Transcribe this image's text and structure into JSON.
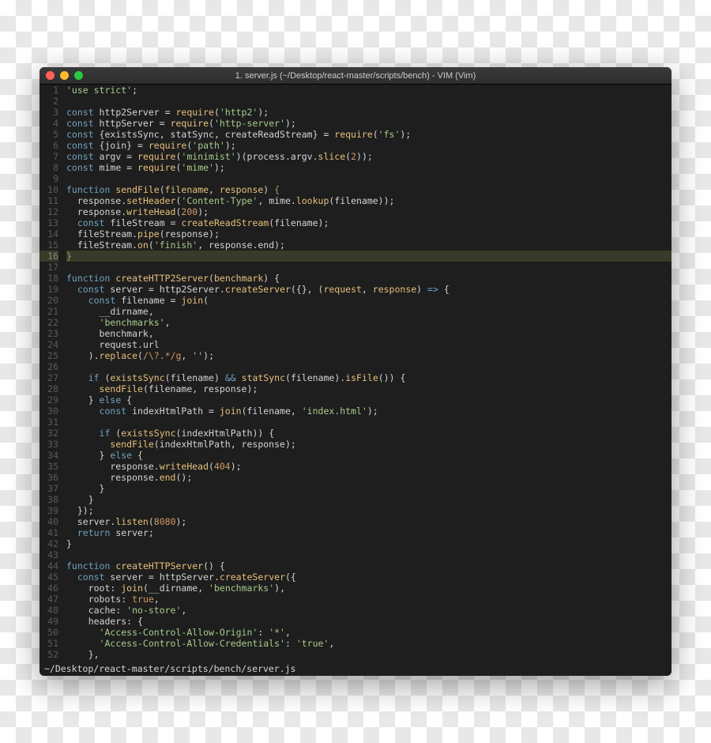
{
  "window": {
    "title": "1. server.js (~/Desktop/react-master/scripts/bench) - VIM (Vim)"
  },
  "status": "~/Desktop/react-master/scripts/bench/server.js",
  "highlight_line": 16,
  "code": [
    [
      [
        "str",
        "'use strict'"
      ],
      [
        "pl",
        ";"
      ]
    ],
    [],
    [
      [
        "kw",
        "const"
      ],
      [
        "pl",
        " http2Server = "
      ],
      [
        "fn",
        "require"
      ],
      [
        "pl",
        "("
      ],
      [
        "str",
        "'http2'"
      ],
      [
        "pl",
        ");"
      ]
    ],
    [
      [
        "kw",
        "const"
      ],
      [
        "pl",
        " httpServer = "
      ],
      [
        "fn",
        "require"
      ],
      [
        "pl",
        "("
      ],
      [
        "str",
        "'http-server'"
      ],
      [
        "pl",
        ");"
      ]
    ],
    [
      [
        "kw",
        "const"
      ],
      [
        "pl",
        " {existsSync, statSync, createReadStream} = "
      ],
      [
        "fn",
        "require"
      ],
      [
        "pl",
        "("
      ],
      [
        "str",
        "'fs'"
      ],
      [
        "pl",
        ");"
      ]
    ],
    [
      [
        "kw",
        "const"
      ],
      [
        "pl",
        " {join} = "
      ],
      [
        "fn",
        "require"
      ],
      [
        "pl",
        "("
      ],
      [
        "str",
        "'path'"
      ],
      [
        "pl",
        ");"
      ]
    ],
    [
      [
        "kw",
        "const"
      ],
      [
        "pl",
        " argv = "
      ],
      [
        "fn",
        "require"
      ],
      [
        "pl",
        "("
      ],
      [
        "str",
        "'minimist'"
      ],
      [
        "pl",
        ")(process.argv."
      ],
      [
        "fn",
        "slice"
      ],
      [
        "pl",
        "("
      ],
      [
        "num",
        "2"
      ],
      [
        "pl",
        "));"
      ]
    ],
    [
      [
        "kw",
        "const"
      ],
      [
        "pl",
        " mime = "
      ],
      [
        "fn",
        "require"
      ],
      [
        "pl",
        "("
      ],
      [
        "str",
        "'mime'"
      ],
      [
        "pl",
        ");"
      ]
    ],
    [],
    [
      [
        "kw",
        "function"
      ],
      [
        "pl",
        " "
      ],
      [
        "fn",
        "sendFile"
      ],
      [
        "pl",
        "("
      ],
      [
        "pr",
        "filename"
      ],
      [
        "pl",
        ", "
      ],
      [
        "pr",
        "response"
      ],
      [
        "pl",
        ") "
      ],
      [
        "br",
        "{"
      ]
    ],
    [
      [
        "pl",
        "  response."
      ],
      [
        "fn",
        "setHeader"
      ],
      [
        "pl",
        "("
      ],
      [
        "str",
        "'Content-Type'"
      ],
      [
        "pl",
        ", mime."
      ],
      [
        "fn",
        "lookup"
      ],
      [
        "pl",
        "(filename));"
      ]
    ],
    [
      [
        "pl",
        "  response."
      ],
      [
        "fn",
        "writeHead"
      ],
      [
        "pl",
        "("
      ],
      [
        "num",
        "200"
      ],
      [
        "pl",
        ");"
      ]
    ],
    [
      [
        "pl",
        "  "
      ],
      [
        "kw",
        "const"
      ],
      [
        "pl",
        " fileStream = "
      ],
      [
        "fn",
        "createReadStream"
      ],
      [
        "pl",
        "(filename);"
      ]
    ],
    [
      [
        "pl",
        "  fileStream."
      ],
      [
        "fn",
        "pipe"
      ],
      [
        "pl",
        "(response);"
      ]
    ],
    [
      [
        "pl",
        "  fileStream."
      ],
      [
        "fn",
        "on"
      ],
      [
        "pl",
        "("
      ],
      [
        "str",
        "'finish'"
      ],
      [
        "pl",
        ", response.end);"
      ]
    ],
    [
      [
        "br",
        "}"
      ]
    ],
    [],
    [
      [
        "kw",
        "function"
      ],
      [
        "pl",
        " "
      ],
      [
        "fn",
        "createHTTP2Server"
      ],
      [
        "pl",
        "("
      ],
      [
        "pr",
        "benchmark"
      ],
      [
        "pl",
        ") {"
      ]
    ],
    [
      [
        "pl",
        "  "
      ],
      [
        "kw",
        "const"
      ],
      [
        "pl",
        " server = http2Server."
      ],
      [
        "fn",
        "createServer"
      ],
      [
        "pl",
        "({}, ("
      ],
      [
        "pr",
        "request"
      ],
      [
        "pl",
        ", "
      ],
      [
        "pr",
        "response"
      ],
      [
        "pl",
        ") "
      ],
      [
        "kw",
        "=>"
      ],
      [
        "pl",
        " {"
      ]
    ],
    [
      [
        "pl",
        "    "
      ],
      [
        "kw",
        "const"
      ],
      [
        "pl",
        " filename = "
      ],
      [
        "fn",
        "join"
      ],
      [
        "pl",
        "("
      ]
    ],
    [
      [
        "pl",
        "      __dirname,"
      ]
    ],
    [
      [
        "pl",
        "      "
      ],
      [
        "str",
        "'benchmarks'"
      ],
      [
        "pl",
        ","
      ]
    ],
    [
      [
        "pl",
        "      benchmark,"
      ]
    ],
    [
      [
        "pl",
        "      request.url"
      ]
    ],
    [
      [
        "pl",
        "    )."
      ],
      [
        "fn",
        "replace"
      ],
      [
        "pl",
        "("
      ],
      [
        "num",
        "/\\?.*/g"
      ],
      [
        "pl",
        ", "
      ],
      [
        "str",
        "''"
      ],
      [
        "pl",
        ");"
      ]
    ],
    [],
    [
      [
        "pl",
        "    "
      ],
      [
        "kw",
        "if"
      ],
      [
        "pl",
        " ("
      ],
      [
        "fn",
        "existsSync"
      ],
      [
        "pl",
        "(filename) "
      ],
      [
        "kw",
        "&&"
      ],
      [
        "pl",
        " "
      ],
      [
        "fn",
        "statSync"
      ],
      [
        "pl",
        "(filename)."
      ],
      [
        "fn",
        "isFile"
      ],
      [
        "pl",
        "()) {"
      ]
    ],
    [
      [
        "pl",
        "      "
      ],
      [
        "fn",
        "sendFile"
      ],
      [
        "pl",
        "(filename, response);"
      ]
    ],
    [
      [
        "pl",
        "    } "
      ],
      [
        "kw",
        "else"
      ],
      [
        "pl",
        " {"
      ]
    ],
    [
      [
        "pl",
        "      "
      ],
      [
        "kw",
        "const"
      ],
      [
        "pl",
        " indexHtmlPath = "
      ],
      [
        "fn",
        "join"
      ],
      [
        "pl",
        "(filename, "
      ],
      [
        "str",
        "'index.html'"
      ],
      [
        "pl",
        ");"
      ]
    ],
    [],
    [
      [
        "pl",
        "      "
      ],
      [
        "kw",
        "if"
      ],
      [
        "pl",
        " ("
      ],
      [
        "fn",
        "existsSync"
      ],
      [
        "pl",
        "(indexHtmlPath)) {"
      ]
    ],
    [
      [
        "pl",
        "        "
      ],
      [
        "fn",
        "sendFile"
      ],
      [
        "pl",
        "(indexHtmlPath, response);"
      ]
    ],
    [
      [
        "pl",
        "      } "
      ],
      [
        "kw",
        "else"
      ],
      [
        "pl",
        " {"
      ]
    ],
    [
      [
        "pl",
        "        response."
      ],
      [
        "fn",
        "writeHead"
      ],
      [
        "pl",
        "("
      ],
      [
        "num",
        "404"
      ],
      [
        "pl",
        ");"
      ]
    ],
    [
      [
        "pl",
        "        response."
      ],
      [
        "fn",
        "end"
      ],
      [
        "pl",
        "();"
      ]
    ],
    [
      [
        "pl",
        "      }"
      ]
    ],
    [
      [
        "pl",
        "    }"
      ]
    ],
    [
      [
        "pl",
        "  });"
      ]
    ],
    [
      [
        "pl",
        "  server."
      ],
      [
        "fn",
        "listen"
      ],
      [
        "pl",
        "("
      ],
      [
        "num",
        "8080"
      ],
      [
        "pl",
        ");"
      ]
    ],
    [
      [
        "pl",
        "  "
      ],
      [
        "kw",
        "return"
      ],
      [
        "pl",
        " server;"
      ]
    ],
    [
      [
        "pl",
        "}"
      ]
    ],
    [],
    [
      [
        "kw",
        "function"
      ],
      [
        "pl",
        " "
      ],
      [
        "fn",
        "createHTTPServer"
      ],
      [
        "pl",
        "() {"
      ]
    ],
    [
      [
        "pl",
        "  "
      ],
      [
        "kw",
        "const"
      ],
      [
        "pl",
        " server = httpServer."
      ],
      [
        "fn",
        "createServer"
      ],
      [
        "pl",
        "({"
      ]
    ],
    [
      [
        "pl",
        "    root: "
      ],
      [
        "fn",
        "join"
      ],
      [
        "pl",
        "(__dirname, "
      ],
      [
        "str",
        "'benchmarks'"
      ],
      [
        "pl",
        "),"
      ]
    ],
    [
      [
        "pl",
        "    robots: "
      ],
      [
        "num",
        "true"
      ],
      [
        "pl",
        ","
      ]
    ],
    [
      [
        "pl",
        "    cache: "
      ],
      [
        "str",
        "'no-store'"
      ],
      [
        "pl",
        ","
      ]
    ],
    [
      [
        "pl",
        "    headers: {"
      ]
    ],
    [
      [
        "pl",
        "      "
      ],
      [
        "str",
        "'Access-Control-Allow-Origin'"
      ],
      [
        "pl",
        ": "
      ],
      [
        "str",
        "'*'"
      ],
      [
        "pl",
        ","
      ]
    ],
    [
      [
        "pl",
        "      "
      ],
      [
        "str",
        "'Access-Control-Allow-Credentials'"
      ],
      [
        "pl",
        ": "
      ],
      [
        "str",
        "'true'"
      ],
      [
        "pl",
        ","
      ]
    ],
    [
      [
        "pl",
        "    },"
      ]
    ],
    [
      [
        "pl",
        "  });"
      ]
    ]
  ]
}
